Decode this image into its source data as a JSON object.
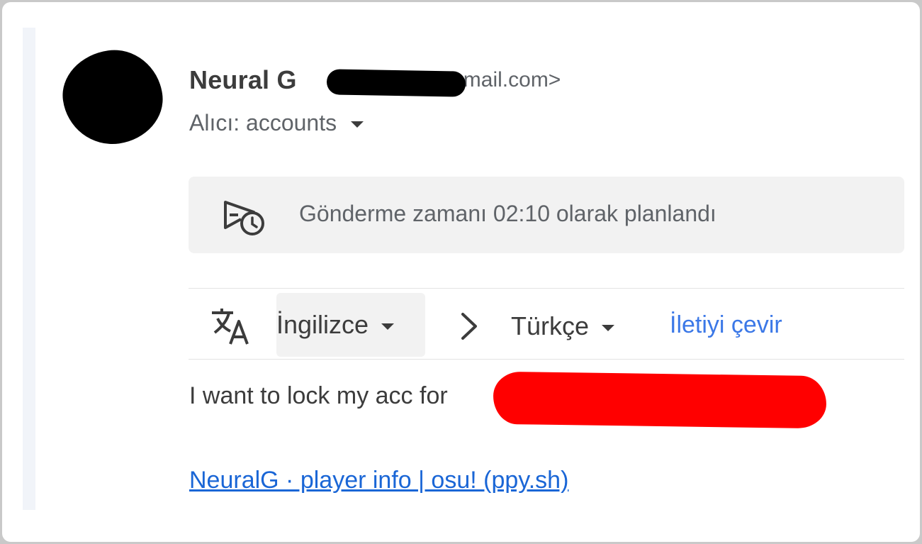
{
  "sender": {
    "name": "Neural G",
    "email_visible": "@gmail.com>"
  },
  "recipient": {
    "label": "Alıcı: accounts"
  },
  "schedule": {
    "text": "Gönderme zamanı 02:10 olarak planlandı"
  },
  "translate_bar": {
    "source_language": "İngilizce",
    "target_language": "Türkçe",
    "translate_link": "İletiyi çevir"
  },
  "message": {
    "body": "I want to lock my acc for",
    "link_text": "NeuralG · player info | osu! (ppy.sh)"
  },
  "colors": {
    "link": "#1a66d6",
    "translate_link": "#3b78e7",
    "redaction_red": "#ff0000",
    "redaction_black": "#000000"
  }
}
